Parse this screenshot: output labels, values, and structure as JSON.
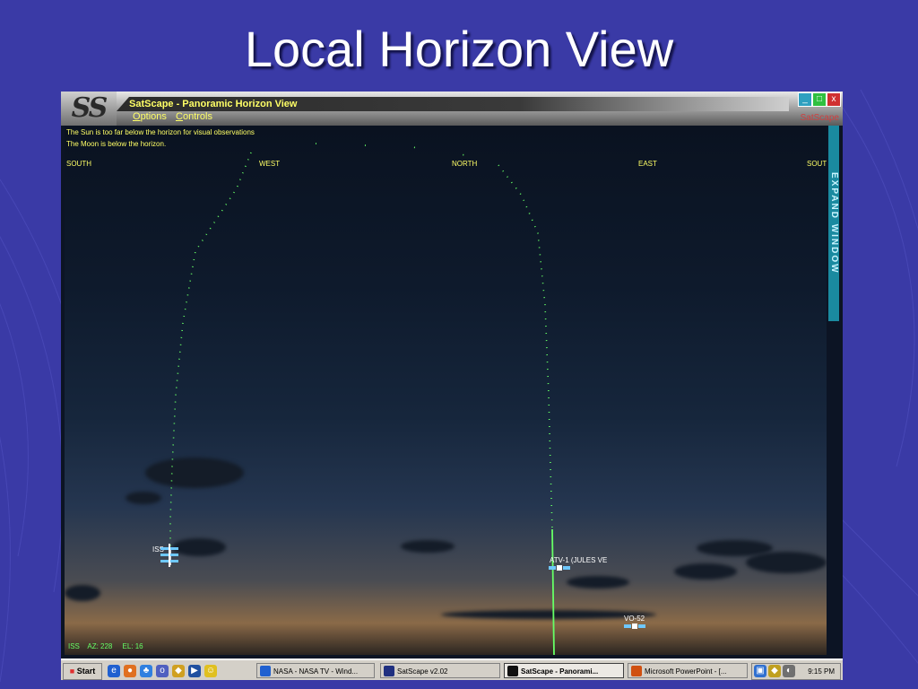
{
  "slide": {
    "title": "Local Horizon View"
  },
  "app": {
    "logo": "SS",
    "title": "SatScape - Panoramic Horizon View",
    "brand": "SatScape",
    "menu": {
      "options_first": "O",
      "options_rest": "ptions",
      "controls_first": "C",
      "controls_rest": "ontrols"
    },
    "window_buttons": {
      "minimize": "_",
      "maximize": "□",
      "close": "x"
    }
  },
  "sky": {
    "sun_message": "The Sun is too far below the horizon for visual observations",
    "moon_message": "The Moon is below the horizon.",
    "compass": [
      "SOUTH",
      "WEST",
      "NORTH",
      "EAST",
      "SOUT"
    ],
    "expand_label": "EXPAND WINDOW",
    "satellites": [
      {
        "name": "ISS"
      },
      {
        "name": "ATV-1 (JULES VE"
      },
      {
        "name": "VO-52"
      }
    ],
    "status": {
      "sat": "ISS",
      "az": "AZ: 228",
      "el": "EL: 16"
    },
    "colors": {
      "trail": "#66ff66",
      "text": "#ffff66",
      "sat": "#6ec8ff"
    }
  },
  "taskbar": {
    "start": "Start",
    "quick_launch": [
      "ie-icon",
      "firefox-icon",
      "msn-icon",
      "outlook-icon",
      "winamp-icon",
      "media-player-icon",
      "messenger-icon"
    ],
    "tasks": [
      {
        "label": "NASA - NASA TV - Wind..."
      },
      {
        "label": "SatScape v2.02"
      },
      {
        "label": "SatScape - Panorami..."
      },
      {
        "label": "Microsoft PowerPoint - [..."
      }
    ],
    "clock": "9:15 PM"
  }
}
